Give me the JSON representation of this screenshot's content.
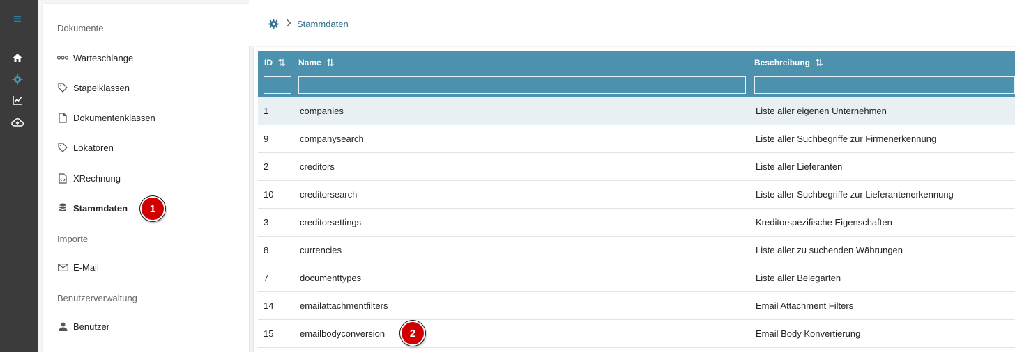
{
  "rail": {
    "icons": [
      "menu-icon",
      "home-icon",
      "gear-icon",
      "chart-icon",
      "cloud-upload-icon"
    ]
  },
  "sidebar": {
    "section_documents": "Dokumente",
    "items_documents": [
      {
        "label": "Warteschlange",
        "icon": "queue-icon"
      },
      {
        "label": "Stapelklassen",
        "icon": "tag-icon"
      },
      {
        "label": "Dokumentenklassen",
        "icon": "file-icon"
      },
      {
        "label": "Lokatoren",
        "icon": "tag-icon"
      },
      {
        "label": "XRechnung",
        "icon": "xml-file-icon"
      },
      {
        "label": "Stammdaten",
        "icon": "database-icon",
        "active": true
      }
    ],
    "section_imports": "Importe",
    "items_imports": [
      {
        "label": "E-Mail",
        "icon": "mail-icon"
      }
    ],
    "section_users": "Benutzerverwaltung",
    "items_users": [
      {
        "label": "Benutzer",
        "icon": "user-icon"
      }
    ]
  },
  "breadcrumb": {
    "current": "Stammdaten"
  },
  "annotations": {
    "badge1": "1",
    "badge2": "2"
  },
  "table": {
    "columns": [
      {
        "label": "ID"
      },
      {
        "label": "Name"
      },
      {
        "label": "Beschreibung"
      }
    ],
    "sort_glyph": "⇅",
    "rows": [
      {
        "id": "1",
        "name": "companies",
        "desc": "Liste aller eigenen Unternehmen"
      },
      {
        "id": "9",
        "name": "companysearch",
        "desc": "Liste aller Suchbegriffe zur Firmenerkennung"
      },
      {
        "id": "2",
        "name": "creditors",
        "desc": "Liste aller Lieferanten"
      },
      {
        "id": "10",
        "name": "creditorsearch",
        "desc": "Liste aller Suchbegriffe zur Lieferantenerkennung"
      },
      {
        "id": "3",
        "name": "creditorsettings",
        "desc": "Kreditorspezifische Eigenschaften"
      },
      {
        "id": "8",
        "name": "currencies",
        "desc": "Liste aller zu suchenden Währungen"
      },
      {
        "id": "7",
        "name": "documenttypes",
        "desc": "Liste aller Belegarten"
      },
      {
        "id": "14",
        "name": "emailattachmentfilters",
        "desc": "Email Attachment Filters"
      },
      {
        "id": "15",
        "name": "emailbodyconversion",
        "desc": "Email Body Konvertierung"
      }
    ]
  },
  "colors": {
    "accent": "#4c92ae",
    "rail": "#3b3b3b",
    "badge": "#d10000",
    "link": "#2a6d8c"
  }
}
